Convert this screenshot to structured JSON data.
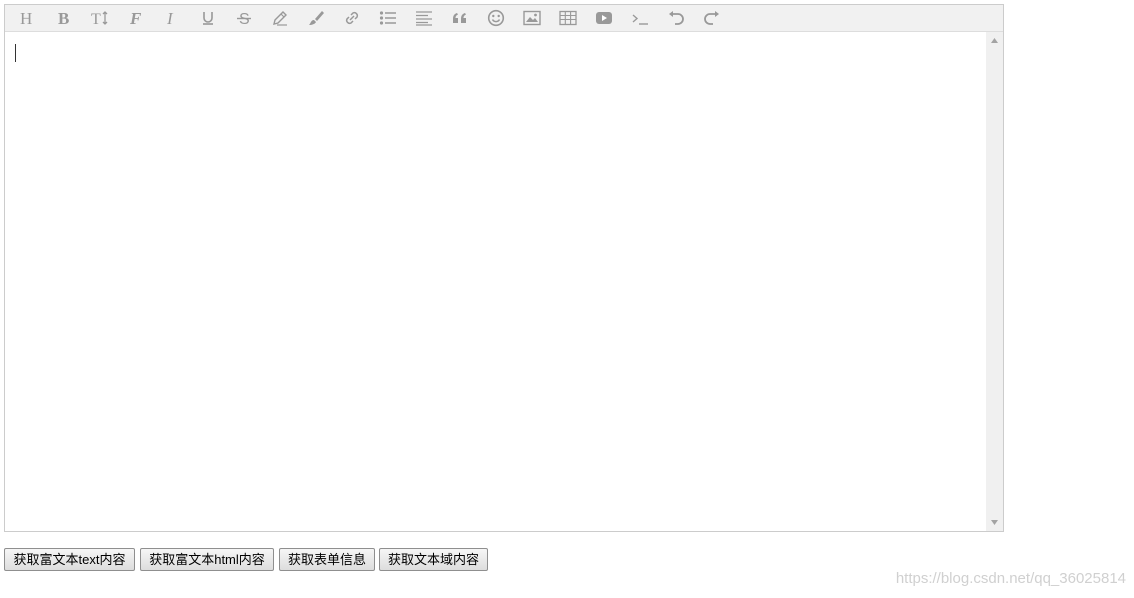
{
  "editor": {
    "toolbar": [
      {
        "name": "head-icon",
        "title": "Heading"
      },
      {
        "name": "bold-icon",
        "title": "Bold"
      },
      {
        "name": "font-size-icon",
        "title": "Font size"
      },
      {
        "name": "font-family-icon",
        "title": "Font family"
      },
      {
        "name": "italic-icon",
        "title": "Italic"
      },
      {
        "name": "underline-icon",
        "title": "Underline"
      },
      {
        "name": "strikethrough-icon",
        "title": "Strikethrough"
      },
      {
        "name": "pencil-icon",
        "title": "Text color"
      },
      {
        "name": "brush-icon",
        "title": "Background color"
      },
      {
        "name": "link-icon",
        "title": "Link"
      },
      {
        "name": "list-icon",
        "title": "List"
      },
      {
        "name": "align-icon",
        "title": "Justify"
      },
      {
        "name": "quote-icon",
        "title": "Quote"
      },
      {
        "name": "emoticon-icon",
        "title": "Emoticon"
      },
      {
        "name": "image-icon",
        "title": "Image"
      },
      {
        "name": "table-icon",
        "title": "Table"
      },
      {
        "name": "video-icon",
        "title": "Video"
      },
      {
        "name": "code-icon",
        "title": "Code"
      },
      {
        "name": "undo-icon",
        "title": "Undo"
      },
      {
        "name": "redo-icon",
        "title": "Redo"
      }
    ],
    "content": ""
  },
  "actions": {
    "get_text_label": "获取富文本text内容",
    "get_html_label": "获取富文本html内容",
    "get_form_label": "获取表单信息",
    "get_textarea_label": "获取文本域内容"
  },
  "watermark": "https://blog.csdn.net/qq_36025814"
}
